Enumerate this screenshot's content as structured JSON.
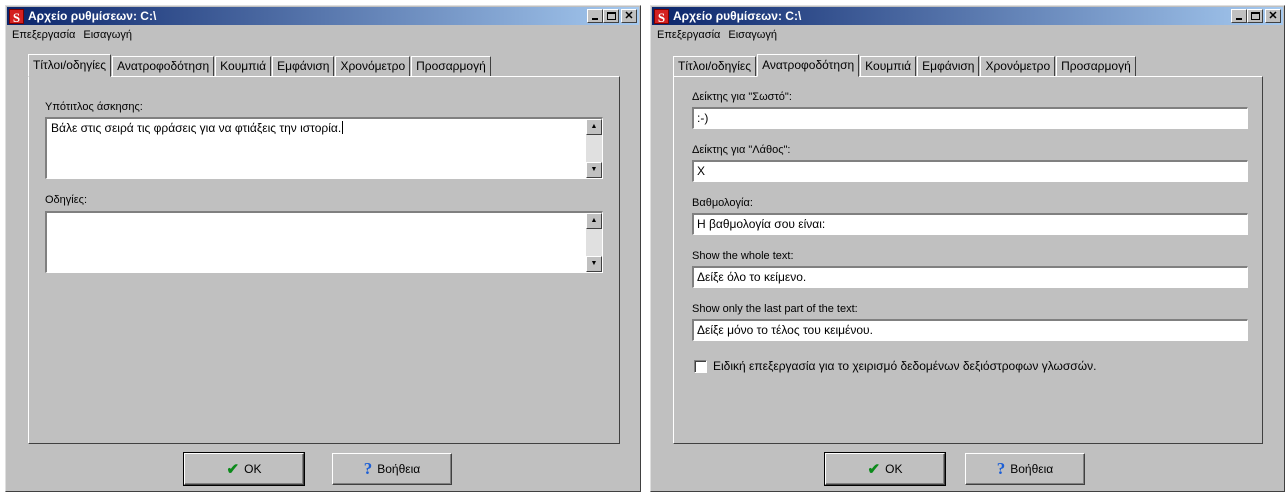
{
  "colors": {
    "window_bg": "#c0c0c0",
    "titlebar_start": "#0a246a",
    "titlebar_end": "#a6caf0",
    "ok_icon": "#0b8a1a",
    "help_icon": "#1c5fd6",
    "app_icon": "#d42020"
  },
  "icons": {
    "app": "S",
    "ok": "checkmark-icon",
    "help": "question-mark-icon"
  },
  "windows": [
    {
      "title": "Αρχείο ρυθμίσεων: C:\\",
      "menu": [
        "Επεξεργασία",
        "Εισαγωγή"
      ],
      "tabs": [
        "Τίτλοι/οδηγίες",
        "Ανατροφοδότηση",
        "Κουμπιά",
        "Εμφάνιση",
        "Χρονόμετρο",
        "Προσαρμογή"
      ],
      "active_tab": "Τίτλοι/οδηγίες",
      "fields": [
        {
          "label": "Υπότιτλος άσκησης:",
          "value": "Βάλε στις σειρά τις φράσεις για να φτιάξεις την ιστορία."
        },
        {
          "label": "Οδηγίες:",
          "value": ""
        }
      ],
      "buttons": {
        "ok": "OK",
        "help": "Βοήθεια"
      }
    },
    {
      "title": "Αρχείο ρυθμίσεων: C:\\",
      "menu": [
        "Επεξεργασία",
        "Εισαγωγή"
      ],
      "tabs": [
        "Τίτλοι/οδηγίες",
        "Ανατροφοδότηση",
        "Κουμπιά",
        "Εμφάνιση",
        "Χρονόμετρο",
        "Προσαρμογή"
      ],
      "active_tab": "Ανατροφοδότηση",
      "fields": [
        {
          "label": "Δείκτης για \"Σωστό\":",
          "value": ":-)"
        },
        {
          "label": "Δείκτης για \"Λάθος\":",
          "value": "X"
        },
        {
          "label": "Βαθμολογία:",
          "value": "Η βαθμολογία σου είναι:"
        },
        {
          "label": "Show the whole text:",
          "value": "Δείξε όλο το κείμενο."
        },
        {
          "label": "Show only the last part of the text:",
          "value": "Δείξε μόνο το τέλος του κειμένου."
        }
      ],
      "checkbox": {
        "label": "Ειδική επεξεργασία για το χειρισμό δεδομένων δεξιόστροφων γλωσσών.",
        "checked": false
      },
      "buttons": {
        "ok": "OK",
        "help": "Βοήθεια"
      }
    }
  ]
}
